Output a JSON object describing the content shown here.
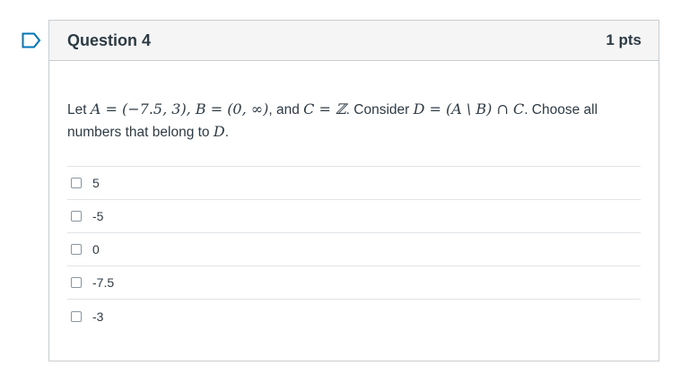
{
  "question": {
    "title": "Question 4",
    "points": "1 pts",
    "text_parts": {
      "p1": "Let ",
      "m1": "A = (−7.5, 3),  B = (0, ∞)",
      "p2": ", and ",
      "m2": "C = ℤ",
      "p3": ". Consider ",
      "m3": "D = (A \\ B) ∩ C",
      "p4": ". Choose all numbers that belong to ",
      "m4": "D",
      "p5": "."
    }
  },
  "answers": [
    {
      "label": "5",
      "checked": false
    },
    {
      "label": "-5",
      "checked": false
    },
    {
      "label": "0",
      "checked": false
    },
    {
      "label": "-7.5",
      "checked": false
    },
    {
      "label": "-3",
      "checked": false
    }
  ],
  "colors": {
    "flag": "#0374b5",
    "header_bg": "#f5f5f5",
    "border": "#c7cdd1",
    "text": "#2d3b45"
  }
}
